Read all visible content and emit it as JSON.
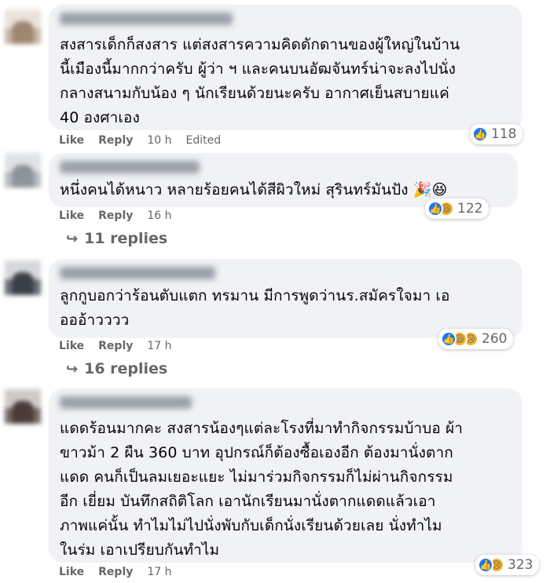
{
  "comments": [
    {
      "text": "สงสารเด็กก็สงสาร แต่สงสารความคิดดักดานของผู้ใหญ่ในบ้าน\nนี้เมืองนี้มากกว่าครับ ผู้ว่า ฯ และคนบนอัฒจันทร์น่าจะลงไปนั่ง\nกลางสนามกับน้อง ๆ นักเรียนด้วยนะครับ อากาศเย็นสบายแค่\n40 องศาเอง",
      "like_label": "Like",
      "reply_label": "Reply",
      "time": "10 h",
      "edited": "Edited",
      "reaction_count": "118",
      "reactions": [
        "like"
      ]
    },
    {
      "text": "หนึ่งคนได้หนาว หลายร้อยคนได้สีผิวใหม่ สุรินทร์มันปัง 🎉😆",
      "like_label": "Like",
      "reply_label": "Reply",
      "time": "16 h",
      "reaction_count": "122",
      "reactions": [
        "like",
        "haha"
      ],
      "replies_label": "11 replies"
    },
    {
      "text": "ลูกกูบอกว่าร้อนตับแตก ทรมาน มีการพูดว่านร.สมัครใจมา เอ\nอออ้าวววว",
      "like_label": "Like",
      "reply_label": "Reply",
      "time": "17 h",
      "reaction_count": "260",
      "reactions": [
        "like",
        "haha",
        "sad"
      ],
      "replies_label": "16 replies"
    },
    {
      "text": "แดดร้อนมากคะ สงสารน้องๆแต่ละโรงที่มาทำกิจกรรมบ้าบอ ผ้า\nขาวม้า 2 ผืน 360 บาท อุปกรณ์ก็ต้องซื้อเองอีก ต้องมานั่งตาก\nแดด คนก็เป็นลมเยอะแยะ ไม่มาร่วมกิจกรรมก็ไม่ผ่านกิจกรรม\nอีก เยี่ยม บันทึกสถิติโลก เอานักเรียนมานั่งตากแดดแล้วเอา\nภาพแค่นั้น ทำไมไม่ไปนั่งพับกับเด็กนั่งเรียนด้วยเลย นั่งทำไม\nในร่ม เอาเปรียบกันทำไม",
      "like_label": "Like",
      "reply_label": "Reply",
      "time": "17 h",
      "reaction_count": "323",
      "reactions": [
        "like",
        "sad"
      ]
    }
  ],
  "colors": {
    "bubble": "#f0f2f5",
    "meta_text": "#65676b",
    "like_blue": "#1877f2",
    "emoji_yellow": "#f7b125"
  },
  "icons": {
    "like": "thumbs-up-icon",
    "haha": "laughing-face-icon",
    "sad": "crying-face-icon",
    "reply_arrow": "reply-arrow-icon"
  }
}
